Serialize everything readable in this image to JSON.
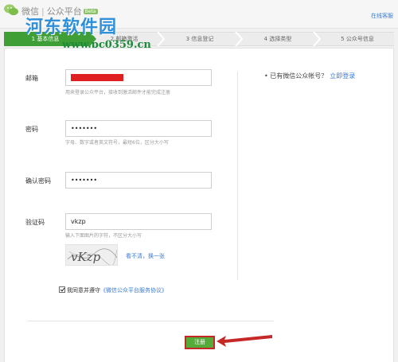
{
  "header": {
    "brand_name": "微信",
    "brand_separator": "|",
    "brand_product": "公众平台",
    "beta_badge": "Beta",
    "help_link": "在线客服"
  },
  "watermark": {
    "title": "河东软件园",
    "url": "www.pc0359.cn"
  },
  "steps": [
    {
      "label": "1 基本信息",
      "active": true
    },
    {
      "label": "2 邮箱激活",
      "active": false
    },
    {
      "label": "3 信息登记",
      "active": false
    },
    {
      "label": "4 选择类型",
      "active": false
    },
    {
      "label": "5 公众号信息",
      "active": false
    }
  ],
  "form": {
    "email": {
      "label": "邮箱",
      "hint": "用来登录公众平台，接收到激活邮件才能完成注册"
    },
    "password": {
      "label": "密码",
      "value": "•••••••",
      "hint": "字母、数字或者英文符号，最短6位，区分大小写"
    },
    "confirm": {
      "label": "确认密码",
      "value": "•••••••"
    },
    "captcha": {
      "label": "验证码",
      "value": "vkzp",
      "hint": "输入下面图片的字符，不区分大小写",
      "image_text": "vKzp",
      "refresh": "看不清，换一张"
    },
    "agree": {
      "checked": true,
      "text": "我同意并遵守",
      "link": "《微信公众平台服务协议》"
    },
    "submit_label": "注册"
  },
  "side": {
    "bullet": "•",
    "question": "已有微信公众帐号？",
    "login_link": "立即登录"
  },
  "colors": {
    "accent_green": "#3f9e35",
    "button_green": "#55ab3a",
    "link_blue": "#3a7bd5",
    "annotation_red": "#c62828"
  }
}
